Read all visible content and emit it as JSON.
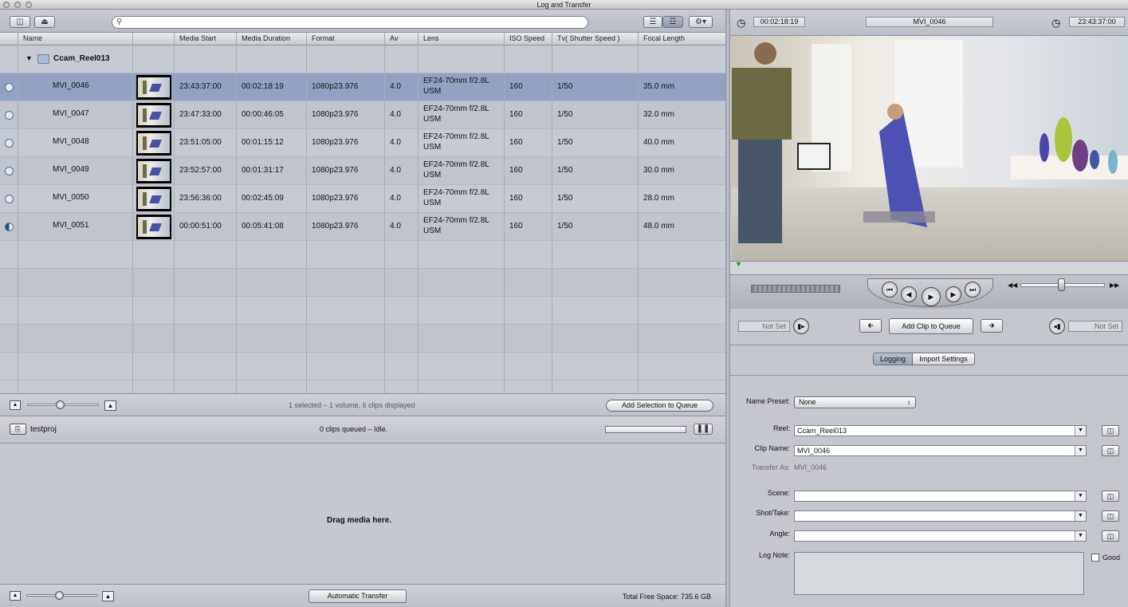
{
  "window": {
    "title": "Log and Transfer"
  },
  "browser": {
    "columns": [
      "Name",
      "Media Start",
      "Media Duration",
      "Format",
      "Av",
      "Lens",
      "ISO Speed",
      "Tv( Shutter Speed )",
      "Focal Length"
    ],
    "reel": "Ccam_Reel013",
    "clips": [
      {
        "name": "MVI_0046",
        "start": "23:43:37:00",
        "duration": "00:02:18:19",
        "format": "1080p23.976",
        "av": "4.0",
        "lens1": "EF24-70mm f/2.8L",
        "lens2": "USM",
        "iso": "160",
        "tv": "1/50",
        "focal": "35.0 mm"
      },
      {
        "name": "MVI_0047",
        "start": "23:47:33:00",
        "duration": "00:00:46:05",
        "format": "1080p23.976",
        "av": "4.0",
        "lens1": "EF24-70mm f/2.8L",
        "lens2": "USM",
        "iso": "160",
        "tv": "1/50",
        "focal": "32.0 mm"
      },
      {
        "name": "MVI_0048",
        "start": "23:51:05:00",
        "duration": "00:01:15:12",
        "format": "1080p23.976",
        "av": "4.0",
        "lens1": "EF24-70mm f/2.8L",
        "lens2": "USM",
        "iso": "160",
        "tv": "1/50",
        "focal": "40.0 mm"
      },
      {
        "name": "MVI_0049",
        "start": "23:52:57:00",
        "duration": "00:01:31:17",
        "format": "1080p23.976",
        "av": "4.0",
        "lens1": "EF24-70mm f/2.8L",
        "lens2": "USM",
        "iso": "160",
        "tv": "1/50",
        "focal": "30.0 mm"
      },
      {
        "name": "MVI_0050",
        "start": "23:56:36:00",
        "duration": "00:02:45:09",
        "format": "1080p23.976",
        "av": "4.0",
        "lens1": "EF24-70mm f/2.8L",
        "lens2": "USM",
        "iso": "160",
        "tv": "1/50",
        "focal": "28.0 mm"
      },
      {
        "name": "MVI_0051",
        "start": "00:00:51:00",
        "duration": "00:05:41:08",
        "format": "1080p23.976",
        "av": "4.0",
        "lens1": "EF24-70mm f/2.8L",
        "lens2": "USM",
        "iso": "160",
        "tv": "1/50",
        "focal": "48.0 mm"
      }
    ],
    "status": "1 selected – 1 volume, 6 clips displayed",
    "add_selection_label": "Add Selection to Queue"
  },
  "queue": {
    "project": "testproj",
    "status": "0 clips queued – Idle.",
    "drop_hint": "Drag media here.",
    "auto_transfer_label": "Automatic Transfer",
    "free_space": "Total Free Space: 735.6 GB"
  },
  "viewer": {
    "duration_tc": "00:02:18:19",
    "clip_name": "MVI_0046",
    "current_tc": "23:43:37:00",
    "in_point": "Not Set",
    "out_point": "Not Set",
    "add_clip_label": "Add Clip to Queue"
  },
  "logging": {
    "tabs": [
      "Logging",
      "Import Settings"
    ],
    "name_preset_label": "Name Preset:",
    "name_preset_value": "None",
    "reel_label": "Reel:",
    "reel_value": "Ccam_Reel013",
    "clip_name_label": "Clip Name:",
    "clip_name_value": "MVI_0046",
    "transfer_as_label": "Transfer As:",
    "transfer_as_value": "MVI_0046",
    "scene_label": "Scene:",
    "shot_label": "Shot/Take:",
    "angle_label": "Angle:",
    "log_note_label": "Log Note:",
    "good_label": "Good"
  },
  "colors": {
    "selected_row": "#93a2c0",
    "panel": "#c2c6ce"
  }
}
